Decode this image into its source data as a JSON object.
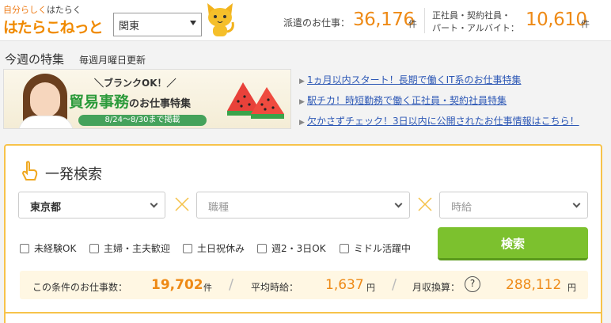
{
  "header": {
    "logo_tagline_prefix": "自分らしく",
    "logo_tagline_suffix": "はたらく",
    "logo_name": "はたらこねっと",
    "region": "関東",
    "dispatch_label": "派遣のお仕事：",
    "dispatch_count": "36,176",
    "dispatch_unit": "件",
    "regular_label_line1": "正社員・契約社員・",
    "regular_label_line2": "パート・アルバイト：",
    "regular_count": "10,610",
    "regular_unit": "件"
  },
  "weekly": {
    "title": "今週の特集",
    "subtitle": "毎週月曜日更新",
    "banner": {
      "tag": "＼ブランクOK！／",
      "main": "貿易事務",
      "main_suffix": "のお仕事特集",
      "dates": "8/24～8/30まで掲載"
    },
    "links": [
      "1ヵ月以内スタート！長期で働くIT系のお仕事特集",
      "駅チカ！時短勤務で働く正社員・契約社員特集",
      "欠かさずチェック！3日以内に公開されたお仕事情報はこちら！"
    ]
  },
  "search": {
    "title": "一発検索",
    "prefecture": "東京都",
    "job_placeholder": "職種",
    "wage_placeholder": "時給",
    "checkboxes": [
      "未経験OK",
      "主婦・主夫歓迎",
      "土日祝休み",
      "週2・3日OK",
      "ミドル活躍中"
    ],
    "button": "検索",
    "summary": {
      "count_label": "この条件のお仕事数：",
      "count": "19,702",
      "count_unit": "件",
      "avg_label": "平均時給：",
      "avg": "1,637",
      "avg_unit": "円",
      "monthly_label": "月収換算：",
      "help_glyph": "?",
      "monthly": "288,112",
      "monthly_unit": "円"
    }
  },
  "colors": {
    "accent_orange": "#ee8a16",
    "panel_border": "#f7c34a",
    "search_green": "#7cc12e",
    "link_blue": "#2c57b5"
  }
}
